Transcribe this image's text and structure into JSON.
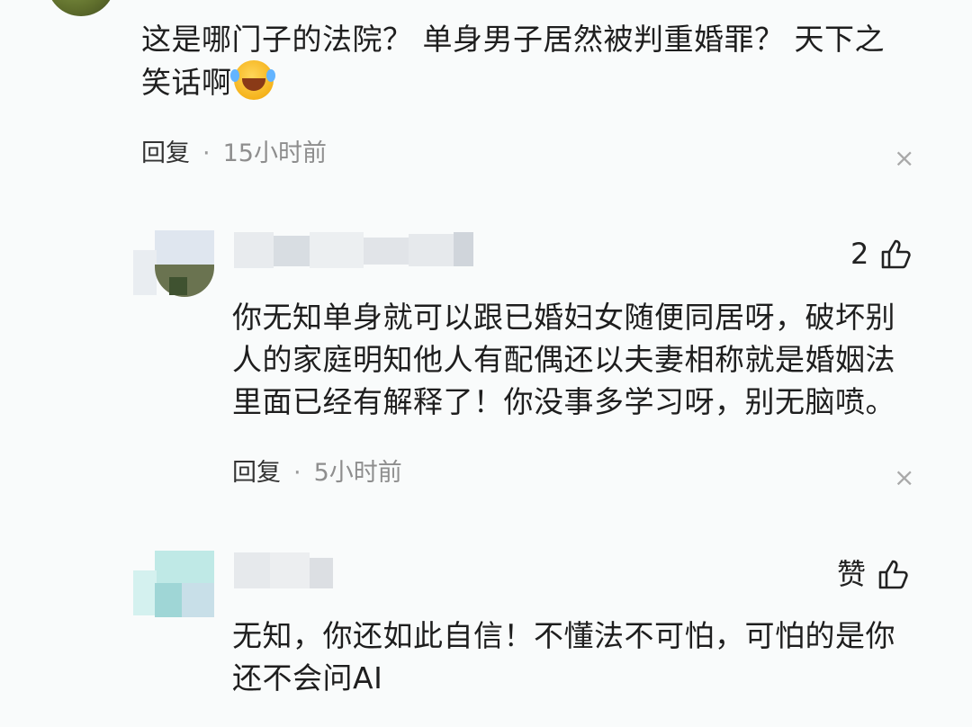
{
  "comment": {
    "line1": "这是哪门子的法院？ 单身男子居然被判重婚罪？ 天下之",
    "line2": "笑话啊",
    "emoji": "laughing-crying-emoji",
    "reply_label": "回复",
    "separator": "·",
    "time": "15小时前",
    "close": "×"
  },
  "replies": [
    {
      "likes": "2",
      "lines": [
        "你无知单身就可以跟已婚妇女随便同居呀，破坏别",
        "人的家庭明知他人有配偶还以夫妻相称就是婚姻法",
        "里面已经有解释了！你没事多学习呀，别无脑喷。"
      ],
      "reply_label": "回复",
      "separator": "·",
      "time": "5小时前",
      "close": "×"
    },
    {
      "likes": "赞",
      "lines": [
        "无知，你还如此自信！不懂法不可怕，可怕的是你",
        "还不会问AI"
      ]
    }
  ],
  "colors": {
    "background": "#f9fbfb",
    "text": "#1e1e1e",
    "muted": "#8e8e8e"
  }
}
